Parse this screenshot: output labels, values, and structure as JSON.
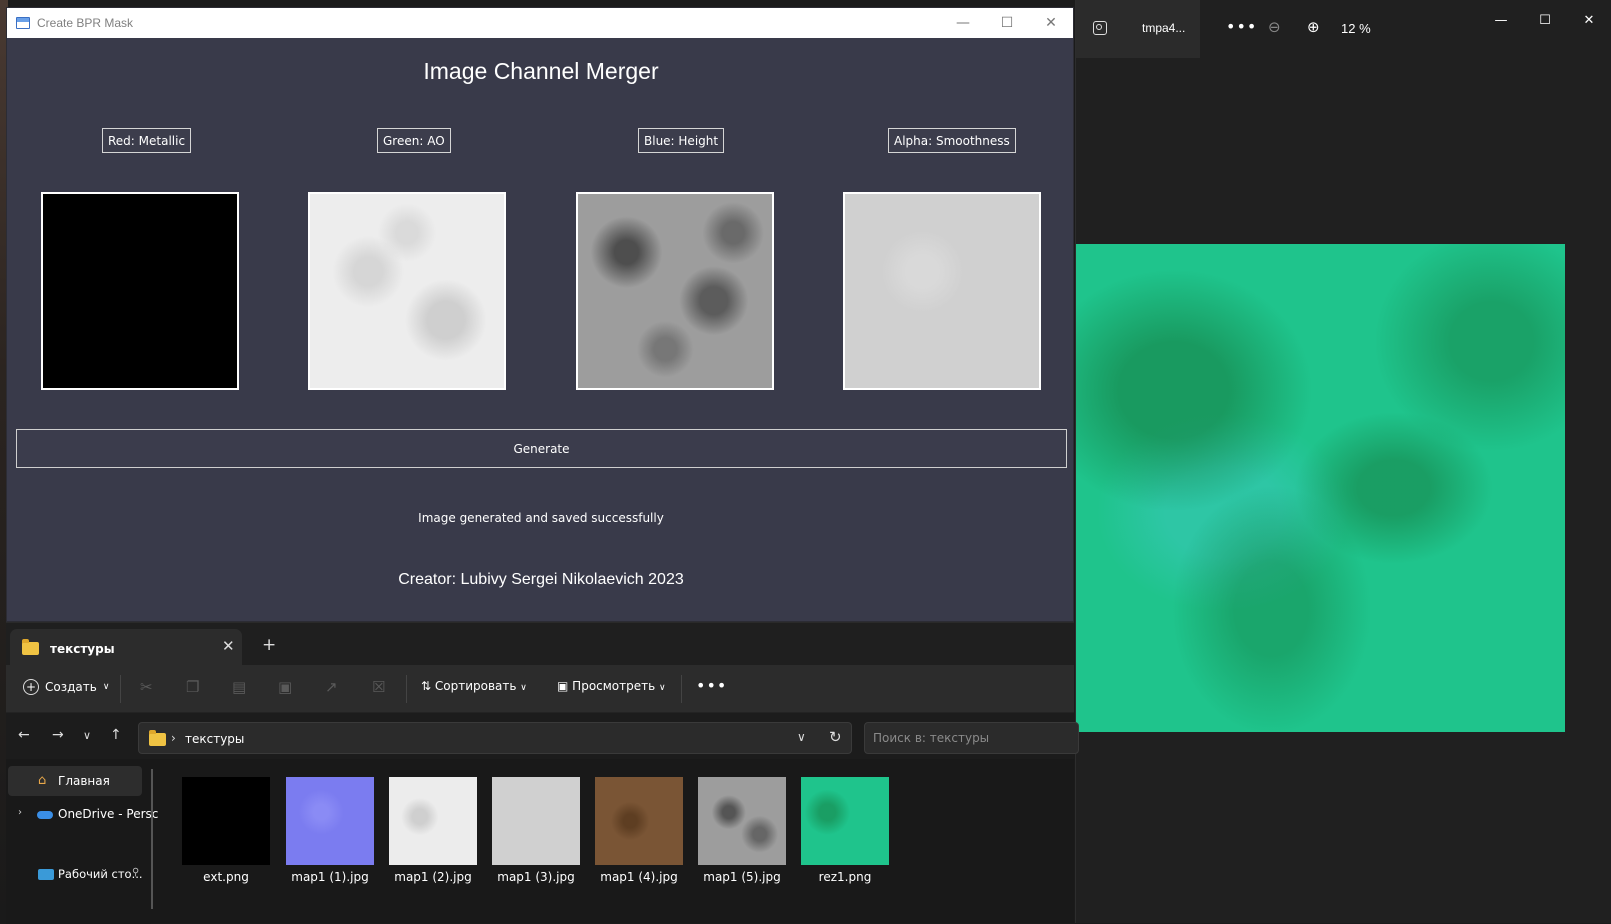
{
  "app": {
    "window_title": "Create BPR Mask",
    "heading": "Image Channel Merger",
    "channels": [
      {
        "label": "Red: Metallic"
      },
      {
        "label": "Green: AO"
      },
      {
        "label": "Blue: Height"
      },
      {
        "label": "Alpha: Smoothness"
      }
    ],
    "generate_label": "Generate",
    "status": "Image generated and saved successfully",
    "creator": "Creator: Lubivy Sergei Nikolaevich 2023"
  },
  "viewer": {
    "file_name": "tmpa4...",
    "zoom": "12 %",
    "image_color": "#1fc48c"
  },
  "explorer": {
    "tab_label": "текстуры",
    "create_label": "Создать",
    "sort_label": "Сортировать",
    "view_label": "Просмотреть",
    "address": "текстуры",
    "search_placeholder": "Поиск в: текстуры",
    "sidebar": {
      "home": "Главная",
      "onedrive": "OneDrive - Persc",
      "desktop": "Рабочий сто..."
    },
    "files": [
      {
        "name": "ext.png",
        "color": "#000000"
      },
      {
        "name": "map1 (1).jpg",
        "color": "#7b7cf0"
      },
      {
        "name": "map1 (2).jpg",
        "color": "#e6e6e6"
      },
      {
        "name": "map1 (3).jpg",
        "color": "#d0d0d0"
      },
      {
        "name": "map1 (4).jpg",
        "color": "#7a5535"
      },
      {
        "name": "map1 (5).jpg",
        "color": "#9a9a9a"
      },
      {
        "name": "rez1.png",
        "color": "#1fc48c"
      }
    ]
  }
}
